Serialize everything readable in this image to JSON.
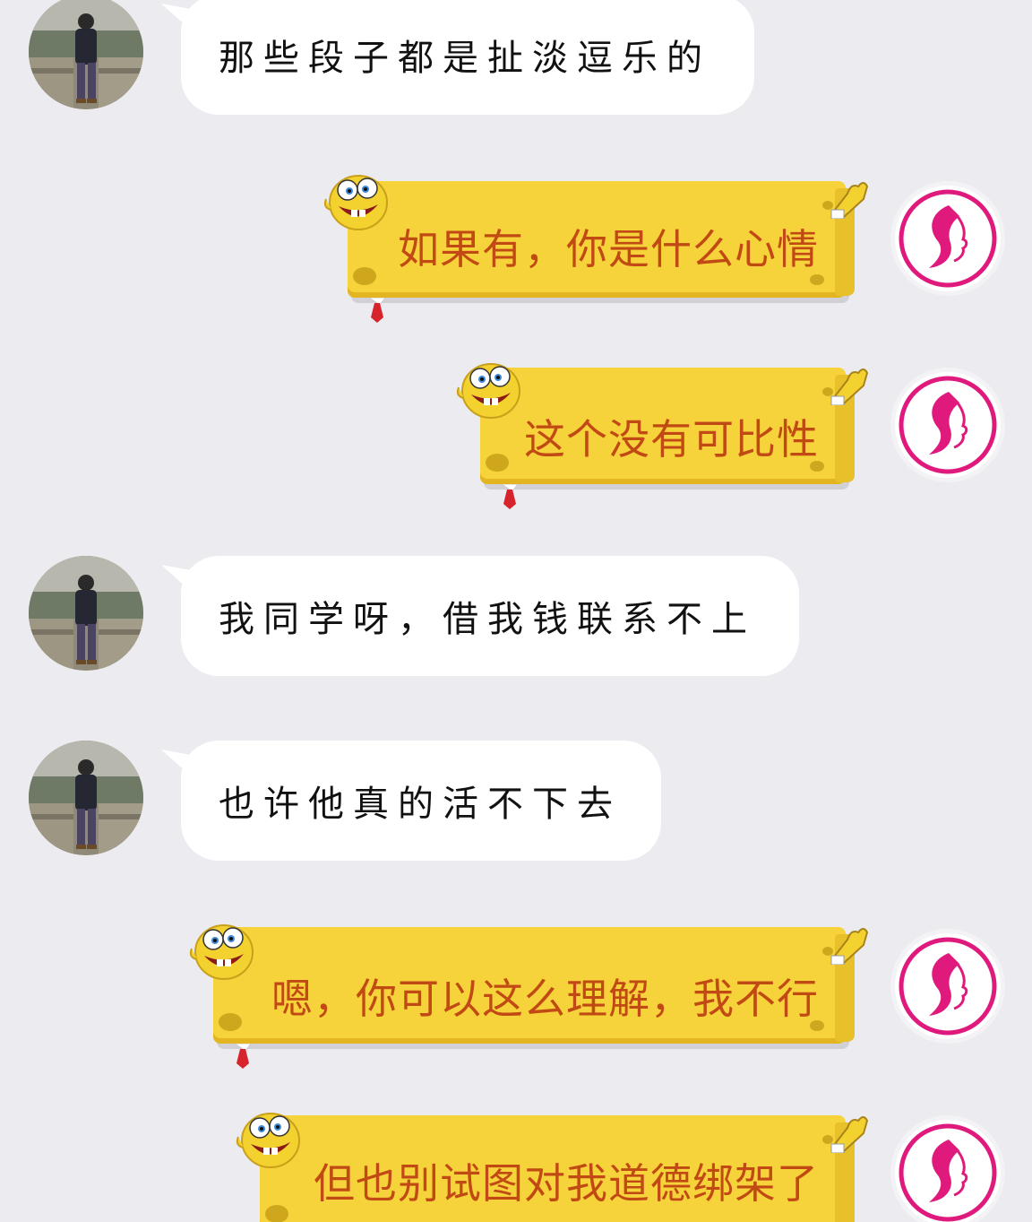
{
  "conversation": {
    "messages": [
      {
        "direction": "incoming",
        "text": "那些段子都是扯淡逗乐的",
        "avatar_icon": "user-photo-avatar"
      },
      {
        "direction": "outgoing",
        "text": "如果有，你是什么心情",
        "avatar_icon": "pink-profile-logo-avatar"
      },
      {
        "direction": "outgoing",
        "text": "这个没有可比性",
        "avatar_icon": "pink-profile-logo-avatar"
      },
      {
        "direction": "incoming",
        "text": "我同学呀，借我钱联系不上",
        "avatar_icon": "user-photo-avatar"
      },
      {
        "direction": "incoming",
        "text": "也许他真的活不下去",
        "avatar_icon": "user-photo-avatar"
      },
      {
        "direction": "outgoing",
        "text": "嗯，你可以这么理解，我不行",
        "avatar_icon": "pink-profile-logo-avatar"
      },
      {
        "direction": "outgoing",
        "text": "但也别试图对我道德绑架了",
        "avatar_icon": "pink-profile-logo-avatar"
      }
    ]
  },
  "colors": {
    "background": "#ebebf0",
    "incoming_bubble": "#ffffff",
    "outgoing_bubble": "#f6d33a",
    "outgoing_text": "#c14a14",
    "avatar_accent": "#e0197d"
  }
}
